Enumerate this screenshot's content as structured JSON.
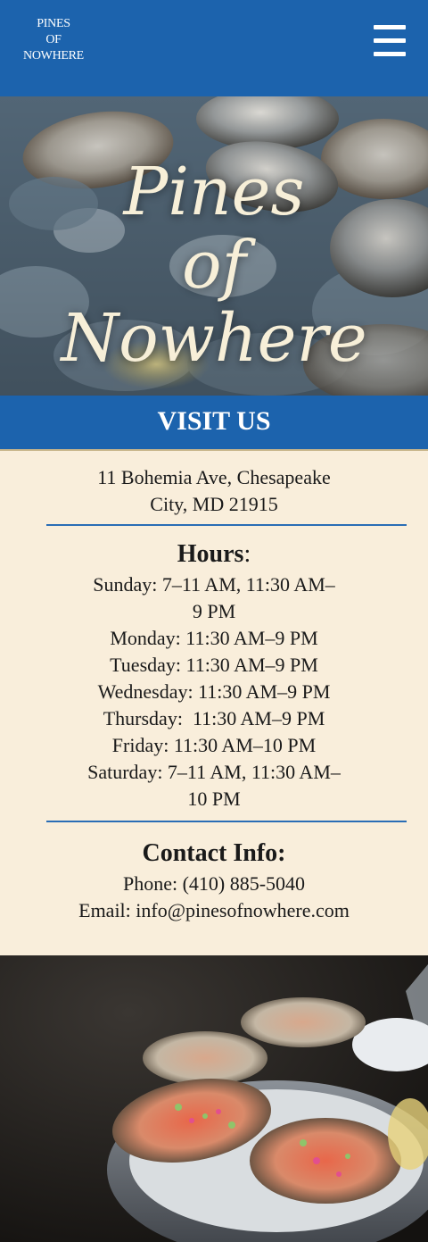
{
  "header": {
    "logo_lines": [
      "PINES",
      "OF",
      "NOWHERE"
    ],
    "menu_icon": "hamburger-menu-icon"
  },
  "hero": {
    "title_lines": [
      "Pines",
      "of",
      "Nowhere"
    ]
  },
  "visit": {
    "heading": "VISIT US"
  },
  "address": {
    "line1": "11 Bohemia Ave, Chesapeake",
    "line2": "City, MD 21915"
  },
  "hours": {
    "label": "Hours",
    "colon": ":",
    "days": [
      {
        "lines": [
          "Sunday: 7–11 AM, 11:30 AM–",
          "9 PM"
        ]
      },
      {
        "lines": [
          "Monday: 11:30 AM–9 PM"
        ]
      },
      {
        "lines": [
          "Tuesday: 11:30 AM–9 PM"
        ]
      },
      {
        "lines": [
          "Wednesday: 11:30 AM–9 PM"
        ]
      },
      {
        "lines": [
          "Thursday:  11:30 AM–9 PM"
        ]
      },
      {
        "lines": [
          "Friday: 11:30 AM–10 PM"
        ]
      },
      {
        "lines": [
          "Saturday: 7–11 AM, 11:30 AM–",
          "10 PM"
        ]
      }
    ]
  },
  "contact": {
    "title": "Contact Info:",
    "phone": "Phone: (410) 885-5040",
    "email": "Email: info@pinesofnowhere.com"
  },
  "colors": {
    "brand_blue": "#1c63ad",
    "cream": "#f9eedb",
    "title_cream": "#f7efd8"
  }
}
